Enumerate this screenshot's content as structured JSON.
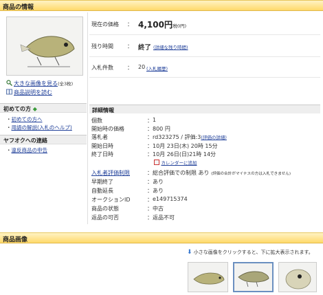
{
  "section1": {
    "title": "商品の情報"
  },
  "left": {
    "enlarge_link": "大きな画像を見る",
    "enlarge_count": "(全3枚)",
    "description_link": "商品説明を読む"
  },
  "beginner": {
    "title": "初めての方",
    "items": [
      "初めての方へ",
      "用語の解説(入札のヘルプ)"
    ]
  },
  "contact": {
    "title": "ヤフオクへの連絡",
    "items": [
      "違反商品の申告"
    ]
  },
  "price": {
    "label": "現在の価格",
    "value": "4,100円",
    "tax": "(税0円)"
  },
  "remaining": {
    "label": "残り時間",
    "value": "終了",
    "detail_link": "(詳細な残り時間)"
  },
  "bids": {
    "label": "入札件数",
    "value": "20",
    "history_link": "(入札履歴)"
  },
  "details": {
    "title": "詳細情報",
    "rows": [
      {
        "label": "個数",
        "value": "1"
      },
      {
        "label": "開始時の価格",
        "value": "800 円"
      },
      {
        "label": "落札者",
        "value": "rd323275 / 評価:3",
        "link": "(評価の詳細)"
      },
      {
        "label": "開始日時",
        "value": "10月 23日(木) 20時 15分"
      },
      {
        "label": "終了日時",
        "value": "10月 26日(日)21時 14分"
      }
    ],
    "calendar_link": "カレンダーに追加",
    "rows2": [
      {
        "label": "入札者評価制限",
        "value": "総合評価での制限 あり",
        "note": "(評価の合計がマイナスの方は入札できません)"
      },
      {
        "label": "早期終了",
        "value": "あり"
      },
      {
        "label": "自動延長",
        "value": "あり"
      },
      {
        "label": "オークションID",
        "value": "e149715374"
      },
      {
        "label": "商品の状態",
        "value": "中古"
      },
      {
        "label": "返品の可否",
        "value": "返品不可"
      }
    ]
  },
  "section2": {
    "title": "商品画像"
  },
  "image_hint": "小さな画像をクリックすると、下に拡大表示されます。"
}
